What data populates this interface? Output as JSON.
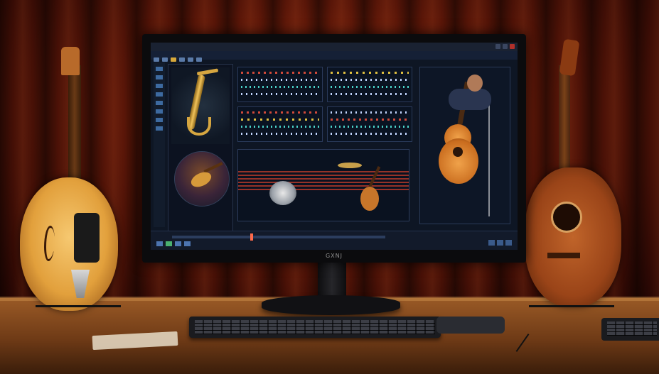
{
  "monitor": {
    "brand_text": "GXNJ"
  },
  "colors": {
    "curtain": "#5a1608",
    "desk": "#8a4e20",
    "screen_bg": "#0e1624",
    "left_guitar": "#e2a03c",
    "right_guitar": "#9a4418"
  },
  "icons": [
    "saxophone-icon",
    "guitar-icon",
    "drum-icon",
    "microphone-icon"
  ]
}
